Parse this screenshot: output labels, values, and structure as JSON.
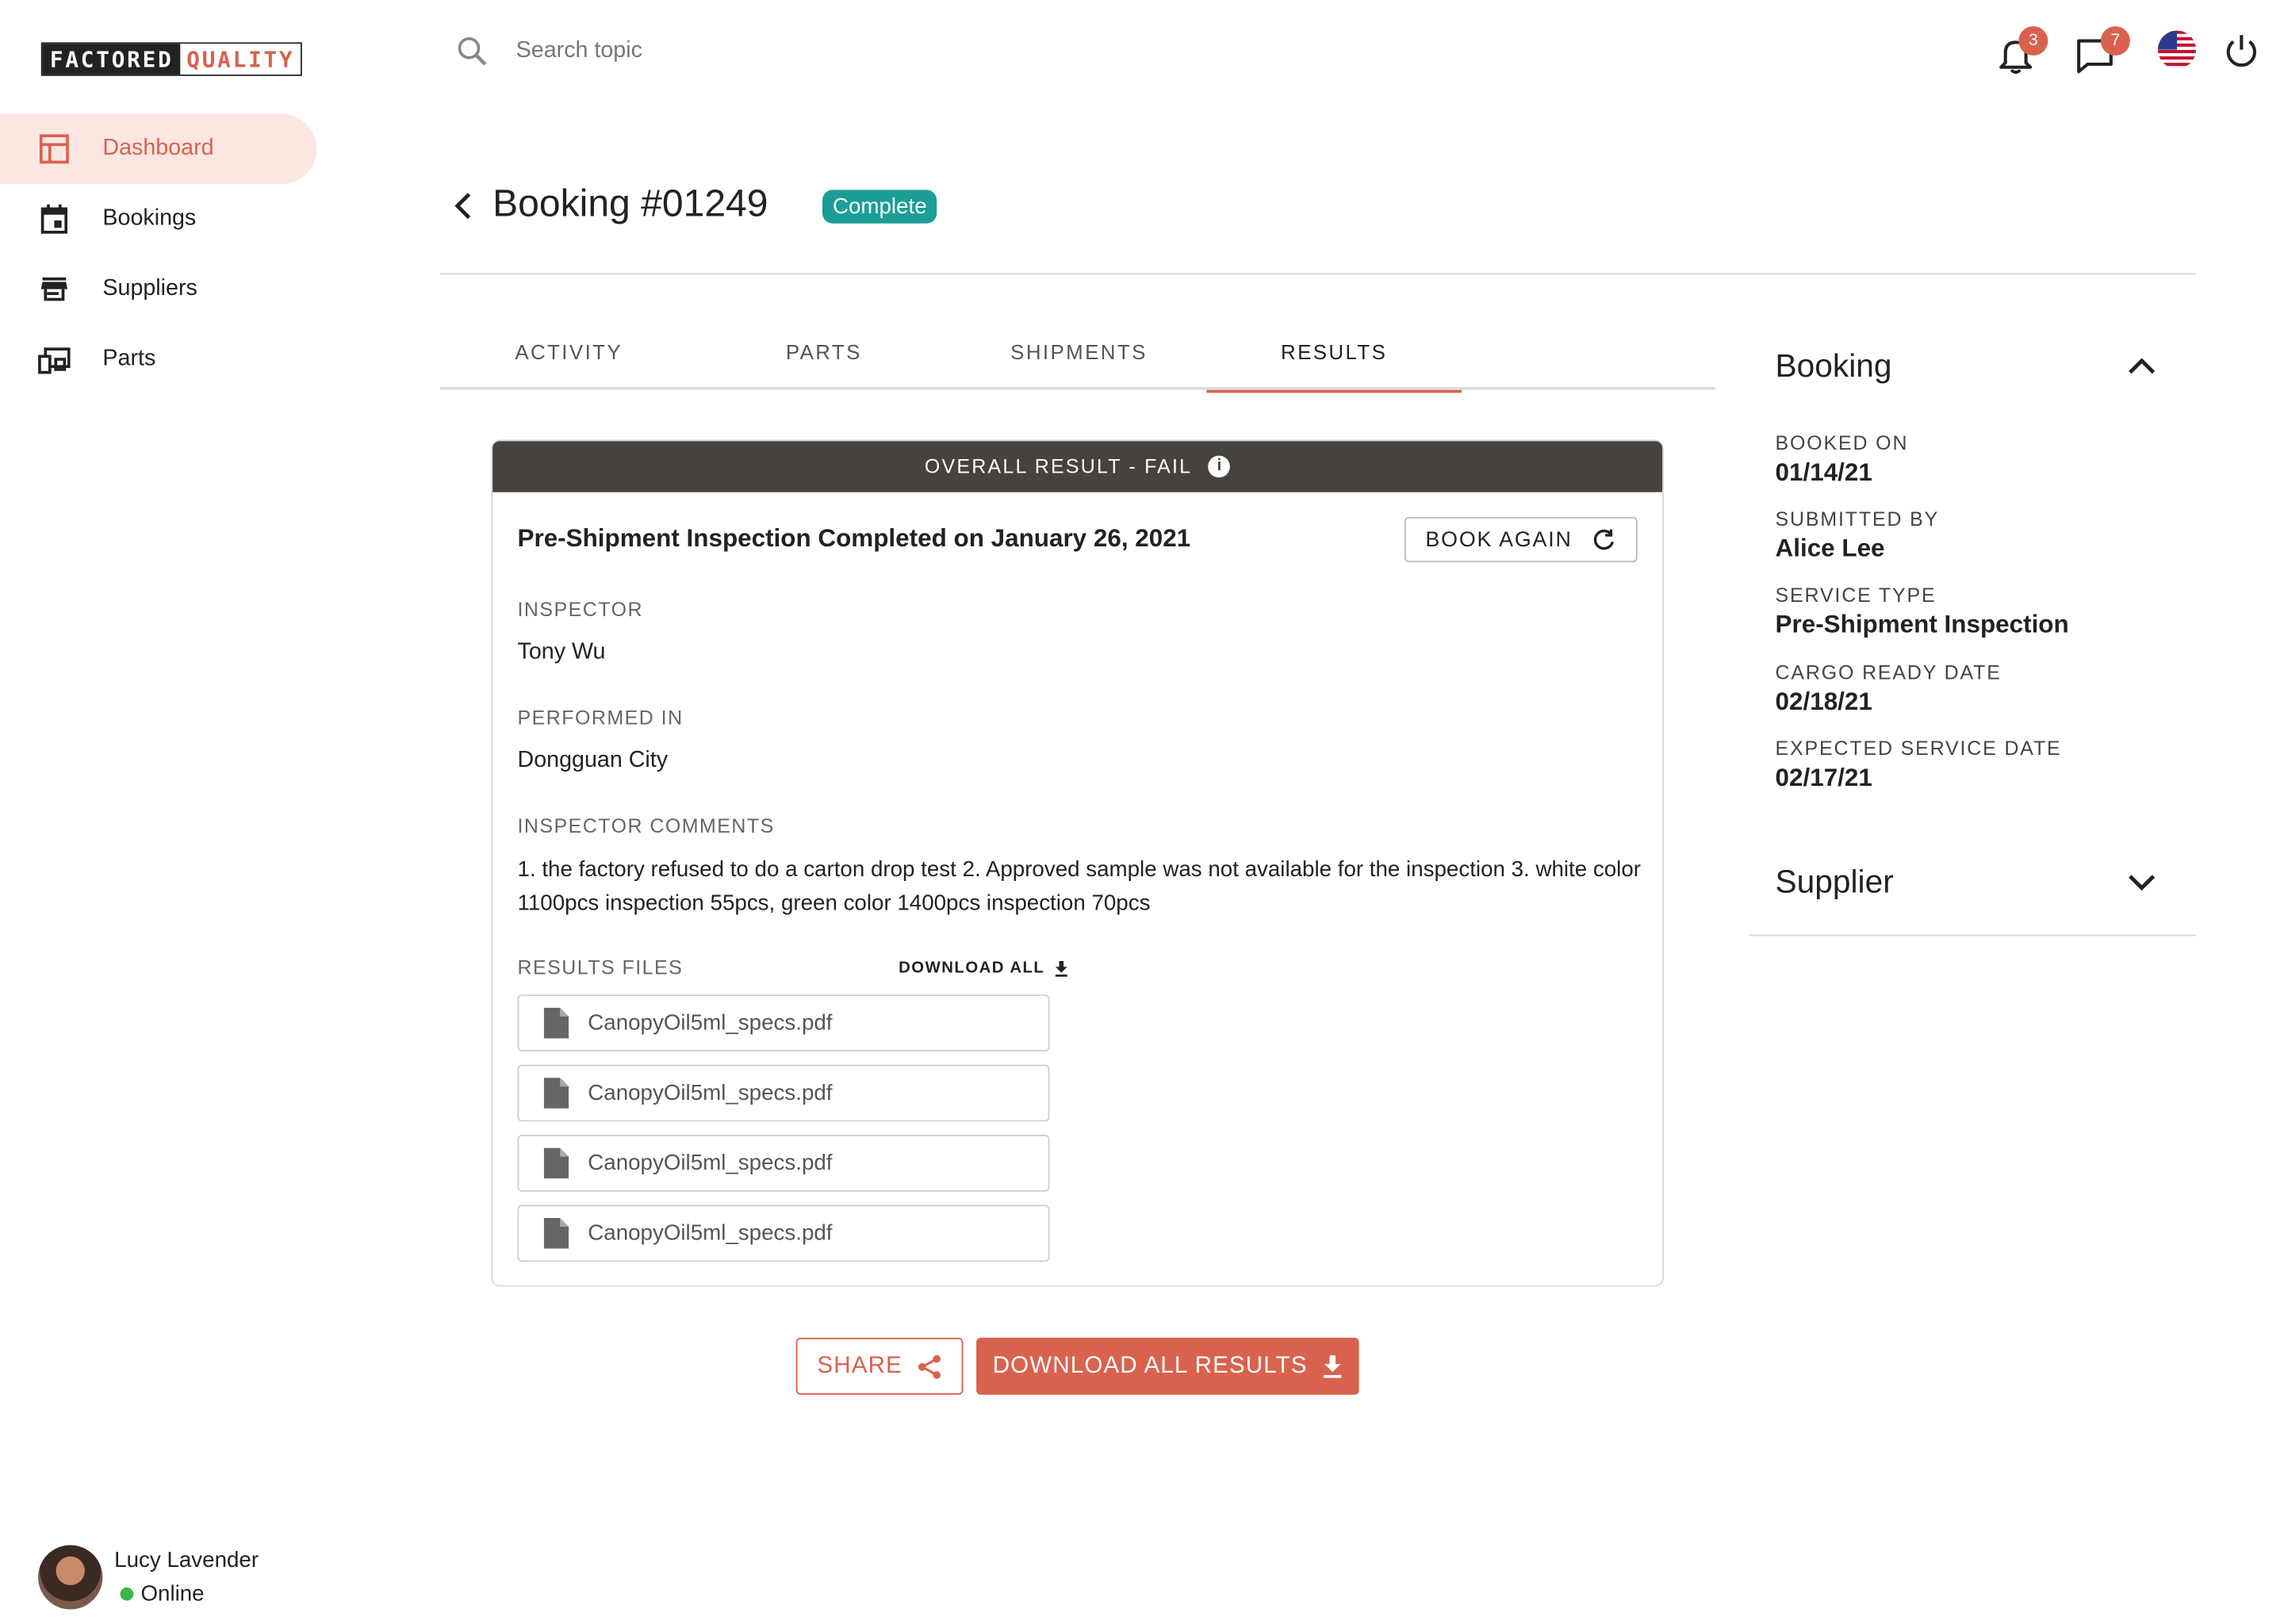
{
  "brand": {
    "logo_left": "FACTORED",
    "logo_right": "QUALITY"
  },
  "sidebar": {
    "items": [
      {
        "label": "Dashboard",
        "icon": "dashboard-icon",
        "active": true
      },
      {
        "label": "Bookings",
        "icon": "calendar-icon",
        "active": false
      },
      {
        "label": "Suppliers",
        "icon": "store-icon",
        "active": false
      },
      {
        "label": "Parts",
        "icon": "devices-icon",
        "active": false
      }
    ]
  },
  "user": {
    "name": "Lucy Lavender",
    "status": "Online"
  },
  "topbar": {
    "search_placeholder": "Search topic",
    "notifications_count": "3",
    "messages_count": "7",
    "locale": "us-flag-icon"
  },
  "header": {
    "title": "Booking #01249",
    "status": "Complete"
  },
  "tabs": [
    {
      "label": "ACTIVITY"
    },
    {
      "label": "PARTS"
    },
    {
      "label": "SHIPMENTS"
    },
    {
      "label": "RESULTS",
      "active": true
    }
  ],
  "result": {
    "banner": "OVERALL RESULT - FAIL",
    "title": "Pre-Shipment Inspection Completed on January 26, 2021",
    "book_again": "BOOK AGAIN",
    "inspector_label": "INSPECTOR",
    "inspector": "Tony Wu",
    "performed_label": "PERFORMED IN",
    "performed": "Dongguan City",
    "comments_label": "INSPECTOR COMMENTS",
    "comments": "1. the factory refused to do a carton drop test 2. Approved sample was not available for the inspection 3. white color 1100pcs inspection 55pcs, green color 1400pcs inspection 70pcs",
    "files_label": "RESULTS FILES",
    "download_all": "DOWNLOAD ALL",
    "files": [
      {
        "name": "CanopyOil5ml_specs.pdf"
      },
      {
        "name": "CanopyOil5ml_specs.pdf"
      },
      {
        "name": "CanopyOil5ml_specs.pdf"
      },
      {
        "name": "CanopyOil5ml_specs.pdf"
      }
    ]
  },
  "actions": {
    "share": "SHARE",
    "download_all_results": "DOWNLOAD ALL RESULTS"
  },
  "booking_panel": {
    "title": "Booking",
    "booked_on_label": "BOOKED ON",
    "booked_on": "01/14/21",
    "submitted_by_label": "SUBMITTED BY",
    "submitted_by": "Alice Lee",
    "service_type_label": "SERVICE TYPE",
    "service_type": "Pre-Shipment Inspection",
    "cargo_ready_label": "CARGO READY DATE",
    "cargo_ready": "02/18/21",
    "expected_service_label": "EXPECTED SERVICE DATE",
    "expected_service": "02/17/21"
  },
  "supplier_panel": {
    "title": "Supplier"
  },
  "colors": {
    "accent": "#d9624e",
    "status": "#1a9e96",
    "banner": "#47423d",
    "online": "#3bb54a"
  }
}
